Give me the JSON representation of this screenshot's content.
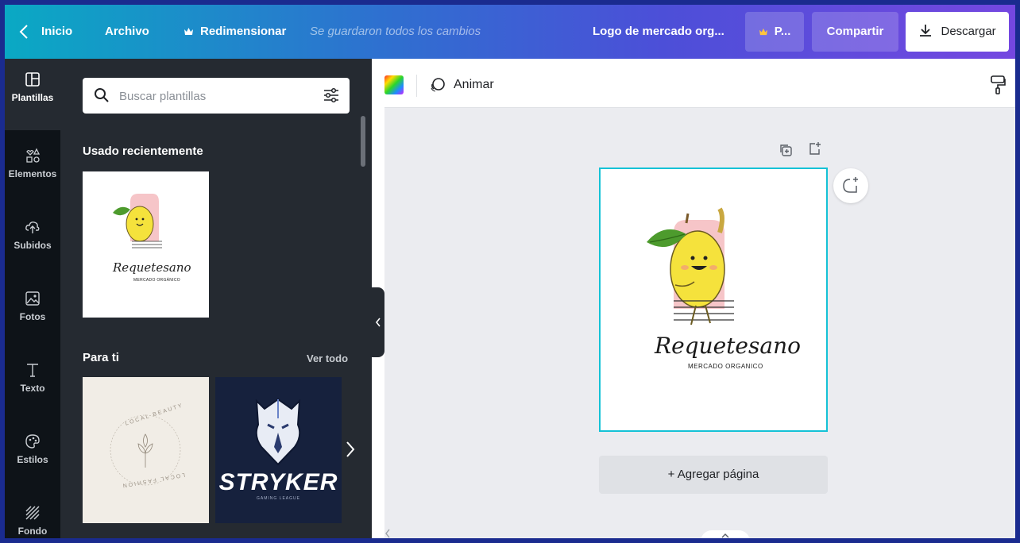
{
  "topbar": {
    "home": "Inicio",
    "file": "Archivo",
    "resize": "Redimensionar",
    "saved_status": "Se guardaron todos los cambios",
    "doc_title": "Logo de mercado org...",
    "pro": "P...",
    "share": "Compartir",
    "download": "Descargar"
  },
  "rail": {
    "items": [
      {
        "label": "Plantillas",
        "icon": "templates-icon"
      },
      {
        "label": "Elementos",
        "icon": "elements-icon"
      },
      {
        "label": "Subidos",
        "icon": "uploads-icon"
      },
      {
        "label": "Fotos",
        "icon": "photos-icon"
      },
      {
        "label": "Texto",
        "icon": "text-icon"
      },
      {
        "label": "Estilos",
        "icon": "styles-icon"
      },
      {
        "label": "Fondo",
        "icon": "background-icon"
      }
    ]
  },
  "panel": {
    "search_placeholder": "Buscar plantillas",
    "recent_title": "Usado recientemente",
    "for_you_title": "Para ti",
    "see_all": "Ver todo",
    "recent_templates": [
      {
        "brand": "Requetesano",
        "tagline": "MERCADO ORGÁNICO"
      }
    ],
    "for_you_templates": [
      {
        "brand_top": "LOCAL BEAUTY",
        "brand_bottom": "LOCAL FASHION"
      },
      {
        "brand": "STRYKER",
        "tagline": "GAMING LEAGUE"
      }
    ]
  },
  "editor": {
    "animate": "Animar",
    "add_page": "+ Agregar página",
    "logo": {
      "brand": "Requetesano",
      "tagline": "MERCADO ORGANICO"
    }
  },
  "colors": {
    "accent": "#14c2d6",
    "rail_bg": "#0e1318",
    "panel_bg": "#252a31",
    "canvas_bg": "#ebecf0"
  }
}
